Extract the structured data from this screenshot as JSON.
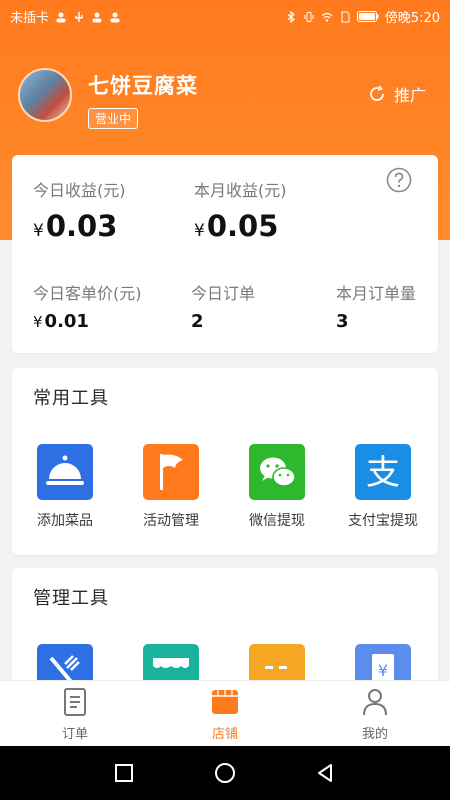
{
  "status_bar": {
    "carrier": "未插卡",
    "time": "傍晚5:20"
  },
  "shop": {
    "name": "七饼豆腐菜",
    "status": "营业中",
    "promote_label": "推广"
  },
  "stats": {
    "today_income_label": "今日收益(元)",
    "today_income_currency": "¥",
    "today_income_value": "0.03",
    "month_income_label": "本月收益(元)",
    "month_income_currency": "¥",
    "month_income_value": "0.05",
    "avg_price_label": "今日客单价(元)",
    "avg_price_currency": "¥",
    "avg_price_value": "0.01",
    "today_orders_label": "今日订单",
    "today_orders_value": "2",
    "month_orders_label": "本月订单量",
    "month_orders_value": "3"
  },
  "common_tools": {
    "title": "常用工具",
    "items": [
      {
        "label": "添加菜品",
        "icon": "food-cloche-icon",
        "color": "#2f6fe4"
      },
      {
        "label": "活动管理",
        "icon": "flag-icon",
        "color": "#ff7a1d"
      },
      {
        "label": "微信提现",
        "icon": "wechat-icon",
        "color": "#2eb82e"
      },
      {
        "label": "支付宝提现",
        "icon": "alipay-icon",
        "color": "#1a8ee6"
      }
    ]
  },
  "management_tools": {
    "title": "管理工具",
    "items": [
      {
        "icon": "fork-knife-icon",
        "color": "#2f6fe4"
      },
      {
        "icon": "storefront-icon",
        "color": "#18b39a"
      },
      {
        "icon": "chat-box-icon",
        "color": "#f5a623"
      },
      {
        "icon": "yen-receipt-icon",
        "color": "#5b8def"
      }
    ]
  },
  "tabbar": {
    "tabs": [
      {
        "label": "订单",
        "icon": "order-icon"
      },
      {
        "label": "店铺",
        "icon": "shop-icon",
        "active": true
      },
      {
        "label": "我的",
        "icon": "profile-icon"
      }
    ]
  },
  "colors": {
    "brand": "#ff7a1d",
    "background": "#f2f2f2"
  }
}
